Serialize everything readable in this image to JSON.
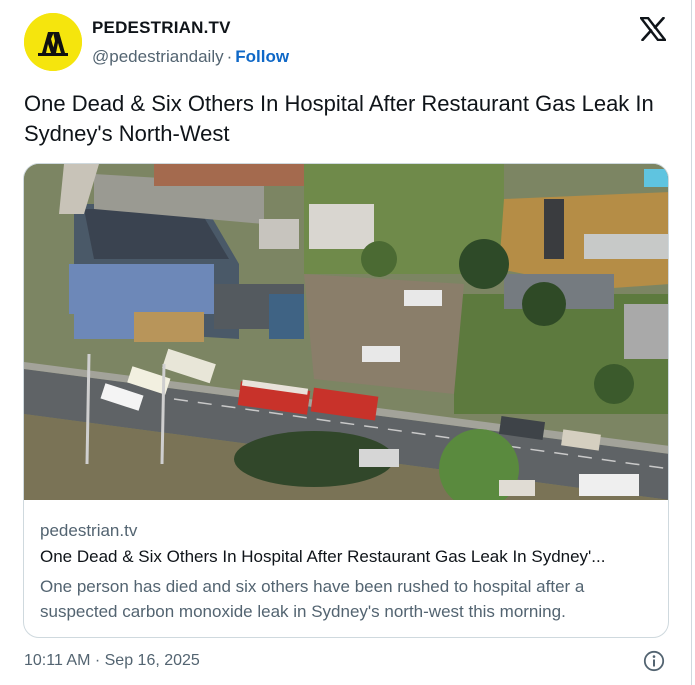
{
  "account": {
    "display_name": "PEDESTRIAN.TV",
    "handle": "@pedestriandaily",
    "separator": "·",
    "follow_label": "Follow",
    "avatar_color": "#f5e50d"
  },
  "tweet": {
    "text": "One Dead & Six Others In Hospital After Restaurant Gas Leak In Sydney's North-West"
  },
  "link_card": {
    "image_icon": "aerial-photo",
    "domain": "pedestrian.tv",
    "title": "One Dead & Six Others In Hospital After Restaurant Gas Leak In Sydney'...",
    "description": "One person has died and six others have been rushed to hospital after a suspected carbon monoxide leak in Sydney's north-west this morning."
  },
  "footer": {
    "timestamp": "10:11 AM · Sep 16, 2025",
    "info_icon": "info-icon"
  },
  "colors": {
    "link_blue": "#0f68c7",
    "secondary_text": "#536471",
    "border": "#cfd9de"
  }
}
